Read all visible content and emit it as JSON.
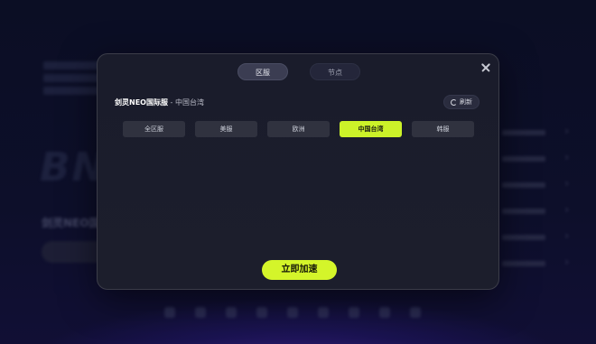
{
  "background": {
    "logo_text": "BNS",
    "game_title": "剑灵NEO国际服"
  },
  "modal": {
    "tabs": [
      {
        "label": "区服",
        "active": true
      },
      {
        "label": "节点",
        "active": false
      }
    ],
    "game_name": "剑灵NEO国际服",
    "separator": " - ",
    "selected_region_text": "中国台湾",
    "refresh_label": "刷新",
    "regions": [
      {
        "label": "全区服",
        "selected": false
      },
      {
        "label": "美服",
        "selected": false
      },
      {
        "label": "欧洲",
        "selected": false
      },
      {
        "label": "中国台湾",
        "selected": true
      },
      {
        "label": "韩服",
        "selected": false
      }
    ],
    "accelerate_label": "立即加速"
  },
  "colors": {
    "accent": "#ccf229",
    "modal_bg": "#1b1d2b",
    "page_bg": "#0b0e24"
  }
}
